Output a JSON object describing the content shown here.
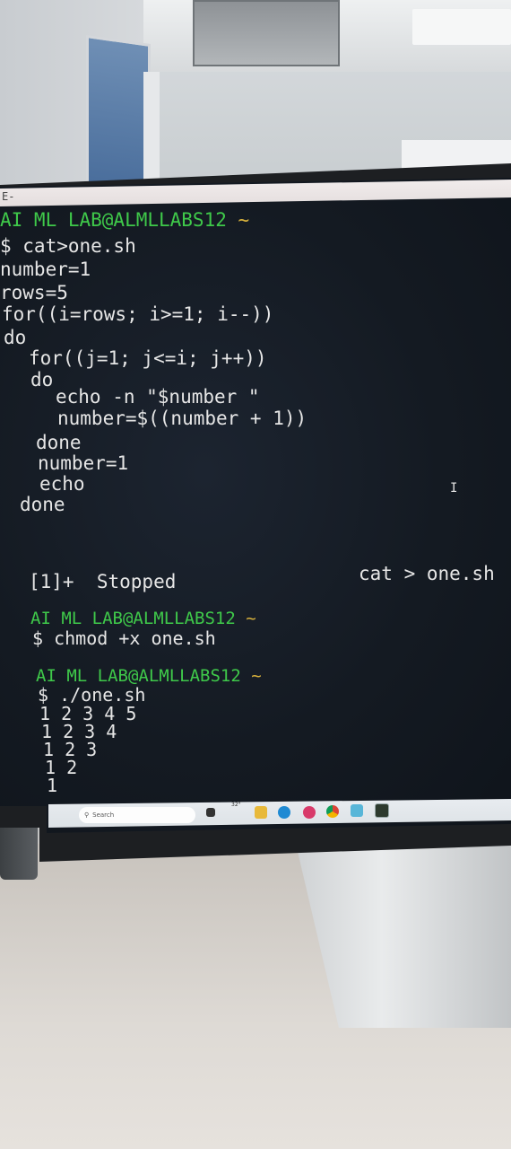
{
  "titlebar": {
    "text": "E-"
  },
  "terminal": {
    "lines": [
      {
        "text": "AI ML LAB@ALMLLABS12",
        "suffix": "~",
        "kind": "prompt"
      },
      {
        "text": "$ cat>one.sh"
      },
      {
        "text": "number=1"
      },
      {
        "text": "rows=5"
      },
      {
        "text": "for((i=rows; i>=1; i--))"
      },
      {
        "text": "do"
      },
      {
        "text": "for((j=1; j<=i; j++))"
      },
      {
        "text": "do"
      },
      {
        "text": "echo -n \"$number \""
      },
      {
        "text": "number=$((number + 1))"
      },
      {
        "text": "done"
      },
      {
        "text": "number=1"
      },
      {
        "text": "echo"
      },
      {
        "text": "done"
      },
      {
        "text": "[1]+  Stopped"
      },
      {
        "text": "cat > one.sh"
      },
      {
        "text": "AI ML LAB@ALMLLABS12",
        "suffix": "~",
        "kind": "prompt"
      },
      {
        "text": "$ chmod +x one.sh"
      },
      {
        "text": "AI ML LAB@ALMLLABS12",
        "suffix": "~",
        "kind": "prompt"
      },
      {
        "text": "$ ./one.sh"
      },
      {
        "text": "1 2 3 4 5"
      },
      {
        "text": "1 2 3 4"
      },
      {
        "text": "1 2 3"
      },
      {
        "text": "1 2"
      },
      {
        "text": "1"
      }
    ],
    "cursor_glyph": "I"
  },
  "taskbar": {
    "search_placeholder": "Search",
    "weather": "32°",
    "icons": [
      "windows-start-icon",
      "search-icon",
      "task-view-icon",
      "weather-icon",
      "file-explorer-icon",
      "edge-browser-icon",
      "app-icon",
      "chrome-icon",
      "notepad-icon",
      "terminal-icon"
    ]
  },
  "colors": {
    "prompt": "#3fc94a",
    "text": "#e6e6e6",
    "tilde": "#d9b23c",
    "screen": "#141a22"
  }
}
